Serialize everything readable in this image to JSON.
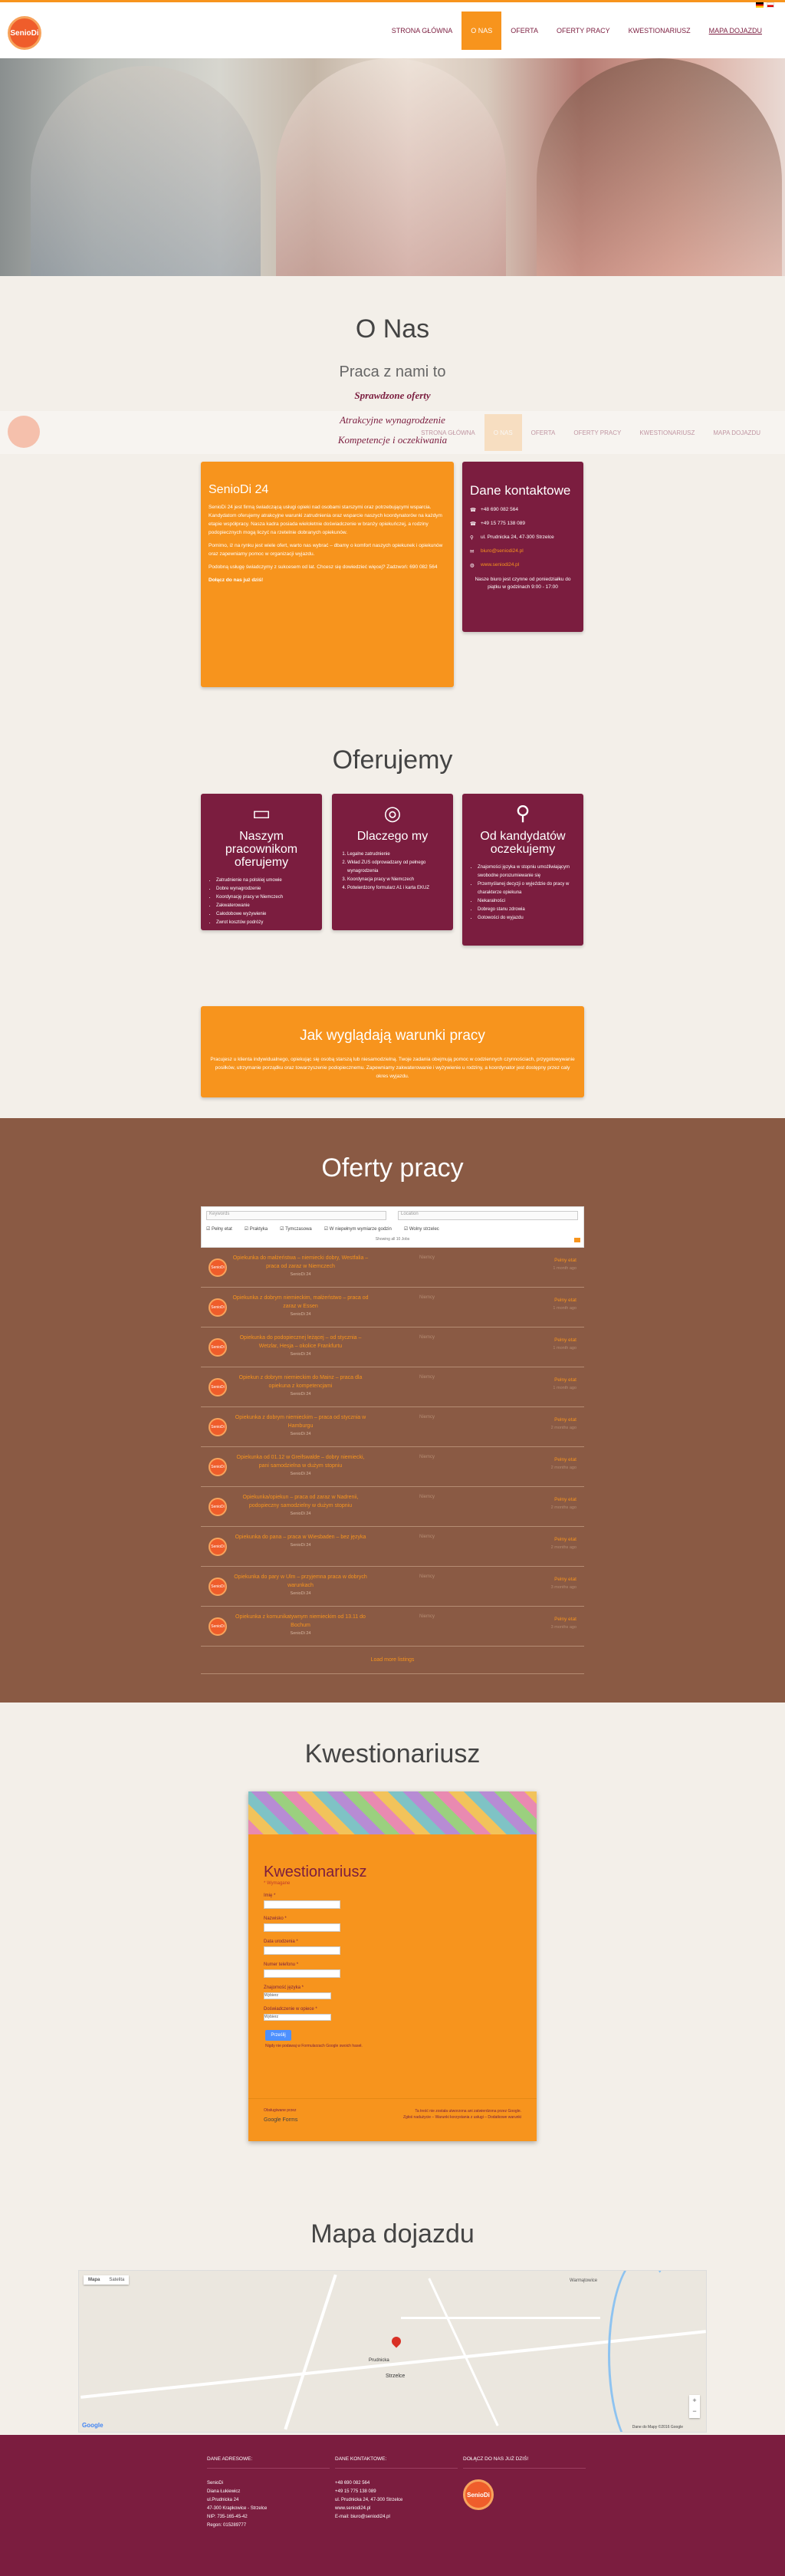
{
  "header": {
    "logo_text": "SenioDi",
    "nav": [
      "STRONA GŁÓWNA",
      "O NAS",
      "OFERTA",
      "OFERTY PRACY",
      "KWESTIONARIUSZ",
      "MAPA DOJAZDU"
    ]
  },
  "onas": {
    "title": "O Nas",
    "subtitle": "Praca z nami to",
    "rotating": [
      "Sprawdzone oferty",
      "Atrakcyjne wynagrodzenie",
      "Kompetencje i oczekiwania"
    ],
    "about": {
      "heading": "SenioDi 24",
      "p1": "SenioDi 24 jest firmą świadczącą usługi opieki nad osobami starszymi oraz potrzebującymi wsparcia. Kandydatom oferujemy atrakcyjne warunki zatrudnienia oraz wsparcie naszych koordynatorów na każdym etapie współpracy. Nasza kadra posiada wieloletnie doświadczenie w branży opiekuńczej, a rodziny podopiecznych mogą liczyć na rzetelnie dobranych opiekunów.",
      "p2": "Pomimo, iż na rynku jest wiele ofert, warto nas wybrać – dbamy o komfort naszych opiekunek i opiekunów oraz zapewniamy pomoc w organizacji wyjazdu.",
      "p3": "Podobną usługę świadczymy z sukcesem od lat. Chcesz się dowiedzieć więcej? Zadzwoń: 690 082 564",
      "closing": "Dołącz do nas już dziś!"
    },
    "contact": {
      "heading": "Dane kontaktowe",
      "phone1": "+48 690 082 564",
      "phone2": "+49 15 775 138 089",
      "address": "ul. Prudnicka 24, 47-300 Strzelce",
      "email": "biuro@seniodi24.pl",
      "web": "www.seniodi24.pl",
      "hours_note": "Nasze biuro jest czynne od poniedziałku do piątku w godzinach 9:00 - 17:00"
    }
  },
  "oferujemy": {
    "title": "Oferujemy",
    "cards": [
      {
        "heading": "Naszym pracownikom oferujemy",
        "items": [
          "Zatrudnienie na polskiej umowie",
          "Dobre wynagrodzenie",
          "Koordynację pracy w Niemczech",
          "Zakwaterowanie",
          "Całodobowe wyżywienie",
          "Zwrot kosztów podróży"
        ]
      },
      {
        "heading": "Dlaczego my",
        "items": [
          "Legalne zatrudnienie",
          "Wkład ZUS odprowadzany od pełnego wynagrodzenia",
          "Koordynacja pracy w Niemczech",
          "Potwierdzony formularz A1 i karta EKUZ"
        ]
      },
      {
        "heading": "Od kandydatów oczekujemy",
        "items": [
          "Znajomości języka w stopniu umożliwiającym swobodne porozumiewanie się",
          "Przemyślanej decyzji o wyjeździe do pracy w charakterze opiekuna",
          "Niekaralności",
          "Dobrego stanu zdrowia",
          "Gotowości do wyjazdu"
        ]
      }
    ],
    "conditions": {
      "heading": "Jak wyglądają warunki pracy",
      "text": "Pracujesz u klienta indywidualnego, opiekując się osobą starszą lub niesamodzielną. Twoje zadania obejmują pomoc w codziennych czynnościach, przygotowywanie posiłków, utrzymanie porządku oraz towarzyszenie podopiecznemu. Zapewniamy zakwaterowanie i wyżywienie u rodziny, a koordynator jest dostępny przez cały okres wyjazdu."
    }
  },
  "jobs": {
    "title": "Oferty pracy",
    "search_placeholder": "Keywords",
    "location_placeholder": "Location",
    "filters": [
      "Pełny etat",
      "Praktyka",
      "Tymczasowa",
      "W niepełnym wymiarze godzin",
      "Wolny strzelec"
    ],
    "count_text": "Showing all 10 Jobs",
    "list": [
      {
        "title": "Opiekunka do małżeństwa – niemiecki dobry, Westfalia – praca od zaraz w Niemczech",
        "company": "SenioDi 24",
        "location": "Niemcy",
        "type": "Pełny etat",
        "date": "1 month ago"
      },
      {
        "title": "Opiekunka z dobrym niemieckim, małżeństwo – praca od zaraz w Essen",
        "company": "SenioDi 24",
        "location": "Niemcy",
        "type": "Pełny etat",
        "date": "1 month ago"
      },
      {
        "title": "Opiekunka do podopiecznej leżącej – od stycznia – Wetzlar, Hesja – okolice Frankfurtu",
        "company": "SenioDi 24",
        "location": "Niemcy",
        "type": "Pełny etat",
        "date": "1 month ago"
      },
      {
        "title": "Opiekun z dobrym niemieckim do Mainz – praca dla opiekuna z kompetencjami",
        "company": "SenioDi 24",
        "location": "Niemcy",
        "type": "Pełny etat",
        "date": "1 month ago"
      },
      {
        "title": "Opiekunka z dobrym niemieckim – praca od stycznia w Hamburgu",
        "company": "SenioDi 24",
        "location": "Niemcy",
        "type": "Pełny etat",
        "date": "2 months ago"
      },
      {
        "title": "Opiekunka od 01.12 w Greifswalde – dobry niemiecki, pani samodzielna w dużym stopniu",
        "company": "SenioDi 24",
        "location": "Niemcy",
        "type": "Pełny etat",
        "date": "2 months ago"
      },
      {
        "title": "Opiekunka/opiekun – praca od zaraz w Nadrenii, podopieczny samodzielny w dużym stopniu",
        "company": "SenioDi 24",
        "location": "Niemcy",
        "type": "Pełny etat",
        "date": "2 months ago"
      },
      {
        "title": "Opiekunka do pana – praca w Wiesbaden – bez języka",
        "company": "SenioDi 24",
        "location": "Niemcy",
        "type": "Pełny etat",
        "date": "2 months ago"
      },
      {
        "title": "Opiekunka do pary w Ulm – przyjemna praca w dobrych warunkach",
        "company": "SenioDi 24",
        "location": "Niemcy",
        "type": "Pełny etat",
        "date": "3 months ago"
      },
      {
        "title": "Opiekunka z komunikatywnym niemieckim od 13.11 do Bochum",
        "company": "SenioDi 24",
        "location": "Niemcy",
        "type": "Pełny etat",
        "date": "3 months ago"
      }
    ],
    "more": "Load more listings"
  },
  "form": {
    "title": "Kwestionariusz",
    "card_title": "Kwestionariusz",
    "required": "* Wymagane",
    "fields": [
      "Imię *",
      "Nazwisko *",
      "Data urodzenia *",
      "Numer telefonu *",
      "Znajomość języka *",
      "Doświadczenie w opiece *"
    ],
    "select_value": "Wybierz",
    "submit": "Prześlij",
    "note": "Nigdy nie podawaj w Formularzach Google swoich haseł.",
    "powered": "Obsługiwane przez",
    "google_forms": "Google Forms",
    "footer_right1": "Ta treść nie została utworzona ani zatwierdzona przez Google.",
    "footer_right2": "Zgłoś nadużycie – Warunki korzystania z usługi – Dodatkowe warunki"
  },
  "map": {
    "title": "Mapa dojazdu",
    "tab_map": "Mapa",
    "tab_sat": "Satelita",
    "google": "Google",
    "attribution": "Dane do Mapy ©2016 Google",
    "labels": [
      "Strzelce",
      "Prudnicka",
      "Warmątowice"
    ]
  },
  "footer": {
    "col1_title": "DANE ADRESOWE:",
    "col1_lines": [
      "SenioDi",
      "Diana Łukiewicz",
      "ul.Prudnicka 24",
      "47-300 Krapkowice - Strzelce",
      "NIP: 735-165-45-42",
      "Regon: 015289777"
    ],
    "col2_title": "DANE KONTAKTOWE:",
    "col2_lines": [
      "+48 690 082 564",
      "+49 15 775 138 089",
      "ul. Prudnicka 24, 47-300 Strzelce",
      "www.seniodi24.pl",
      "E-mail: biuro@seniodi24.pl"
    ],
    "col3_title": "DOŁĄCZ DO NAS JUŻ DZIŚ!",
    "logo_text": "SenioDi"
  }
}
